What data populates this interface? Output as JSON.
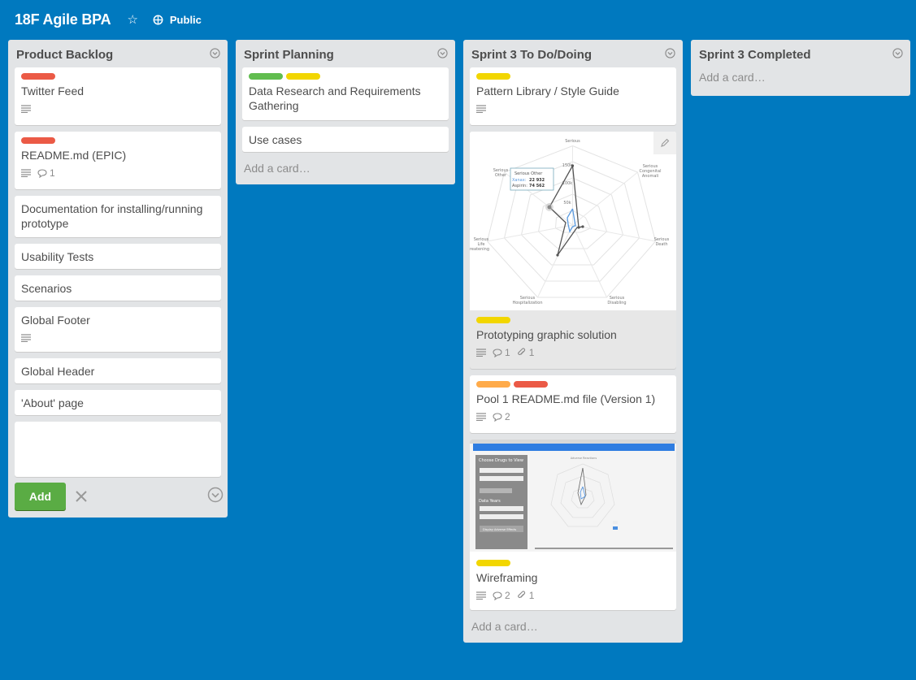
{
  "board": {
    "title": "18F Agile BPA",
    "visibility": "Public",
    "icons": {
      "star": "star-icon",
      "visibility": "globe-icon"
    }
  },
  "colors": {
    "background": "#0079bf",
    "red": "#eb5a46",
    "green": "#61bd4f",
    "yellow": "#f2d600",
    "orange": "#ffab4a",
    "add_button": "#5aac44"
  },
  "lists": [
    {
      "title": "Product Backlog",
      "cards": [
        {
          "title": "Twitter Feed",
          "labels": [
            "red"
          ],
          "description": true
        },
        {
          "title": "README.md (EPIC)",
          "labels": [
            "red"
          ],
          "description": true,
          "comments": "1"
        },
        {
          "title": "Documentation for installing/running prototype",
          "labels": []
        },
        {
          "title": "Usability Tests",
          "labels": []
        },
        {
          "title": "Scenarios",
          "labels": []
        },
        {
          "title": "Global Footer",
          "labels": [],
          "description": true
        },
        {
          "title": "Global Header",
          "labels": []
        },
        {
          "title": "'About' page",
          "labels": []
        }
      ],
      "composer": {
        "add_label": "Add",
        "value": ""
      }
    },
    {
      "title": "Sprint Planning",
      "cards": [
        {
          "title": "Data Research and Requirements Gathering",
          "labels": [
            "green",
            "yellow"
          ]
        },
        {
          "title": "Use cases",
          "labels": []
        }
      ],
      "add_card": "Add a card…"
    },
    {
      "title": "Sprint 3 To Do/Doing",
      "cards": [
        {
          "title": "Pattern Library / Style Guide",
          "labels": [
            "yellow"
          ],
          "description": true
        },
        {
          "title": "Prototyping graphic solution",
          "labels": [
            "yellow"
          ],
          "description": true,
          "comments": "1",
          "attachments": "1",
          "cover": {
            "axes": [
              "Serious",
              "Serious Congenital Anomali",
              "Serious Death",
              "Serious Disabling",
              "Serious Hospitalization",
              "Serious Life reatening",
              "Serious Other"
            ],
            "ticks": [
              "150k",
              "100k",
              "50k"
            ],
            "tooltip": {
              "title": "Serious Other",
              "rows": [
                {
                  "name": "Xanax:",
                  "value": "22 932"
                },
                {
                  "name": "Aspirin:",
                  "value": "74 562"
                }
              ]
            }
          }
        },
        {
          "title": "Pool 1 README.md file (Version 1)",
          "labels": [
            "orange",
            "red"
          ],
          "description": true,
          "comments": "2"
        },
        {
          "title": "Wireframing",
          "labels": [
            "yellow"
          ],
          "description": true,
          "comments": "2",
          "attachments": "1",
          "screenshot": {
            "panel_title": "Choose Drugs to View",
            "years_label": "Data Years",
            "button_label": "Display Adverse Effects",
            "chart_title": "Adverse Reactions"
          }
        }
      ],
      "add_card": "Add a card…"
    },
    {
      "title": "Sprint 3 Completed",
      "cards": [],
      "add_card": "Add a card…"
    }
  ]
}
